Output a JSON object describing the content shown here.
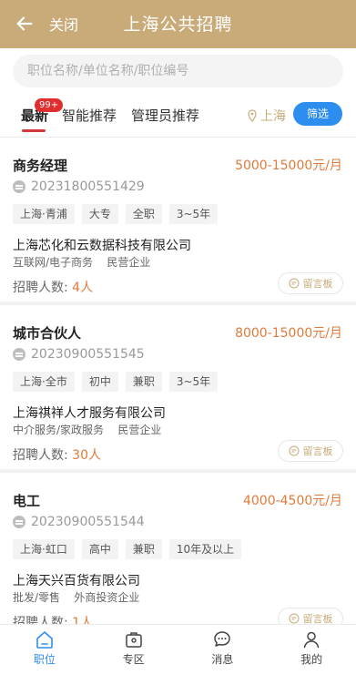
{
  "header": {
    "back_label": "关闭",
    "title": "上海公共招聘"
  },
  "search": {
    "placeholder": "职位名称/单位名称/职位编号"
  },
  "tabs": [
    {
      "label": "最新",
      "badge": "99+"
    },
    {
      "label": "智能推荐"
    },
    {
      "label": "管理员推荐"
    }
  ],
  "location": "上海",
  "filter_label": "筛选",
  "jobs": [
    {
      "title": "商务经理",
      "salary": "5000-15000元/月",
      "code": "20231800551429",
      "tags": [
        "上海·青浦",
        "大专",
        "全职",
        "3~5年"
      ],
      "company": "上海芯化和云数据科技有限公司",
      "industry": "互联网/电子商务",
      "company_type": "民营企业",
      "hire_label": "招聘人数:",
      "hire_count": "4人",
      "message_label": "留言板"
    },
    {
      "title": "城市合伙人",
      "salary": "8000-15000元/月",
      "code": "20230900551545",
      "tags": [
        "上海·全市",
        "初中",
        "兼职",
        "3~5年"
      ],
      "company": "上海祺祥人才服务有限公司",
      "industry": "中介服务/家政服务",
      "company_type": "民营企业",
      "hire_label": "招聘人数:",
      "hire_count": "30人",
      "message_label": "留言板"
    },
    {
      "title": "电工",
      "salary": "4000-4500元/月",
      "code": "20230900551544",
      "tags": [
        "上海·虹口",
        "高中",
        "兼职",
        "10年及以上"
      ],
      "company": "上海天兴百货有限公司",
      "industry": "批发/零售",
      "company_type": "外商投资企业",
      "hire_label": "招聘人数:",
      "hire_count": "1人",
      "message_label": "留言板"
    }
  ],
  "bottom_nav": [
    {
      "label": "职位",
      "icon": "home-icon",
      "active": true
    },
    {
      "label": "专区",
      "icon": "briefcase-icon"
    },
    {
      "label": "消息",
      "icon": "chat-icon"
    },
    {
      "label": "我的",
      "icon": "person-icon"
    }
  ],
  "colors": {
    "header": "#c8ab78",
    "accent": "#2e8ef0",
    "salary": "#e07b3a",
    "badge": "#e02e2e"
  }
}
